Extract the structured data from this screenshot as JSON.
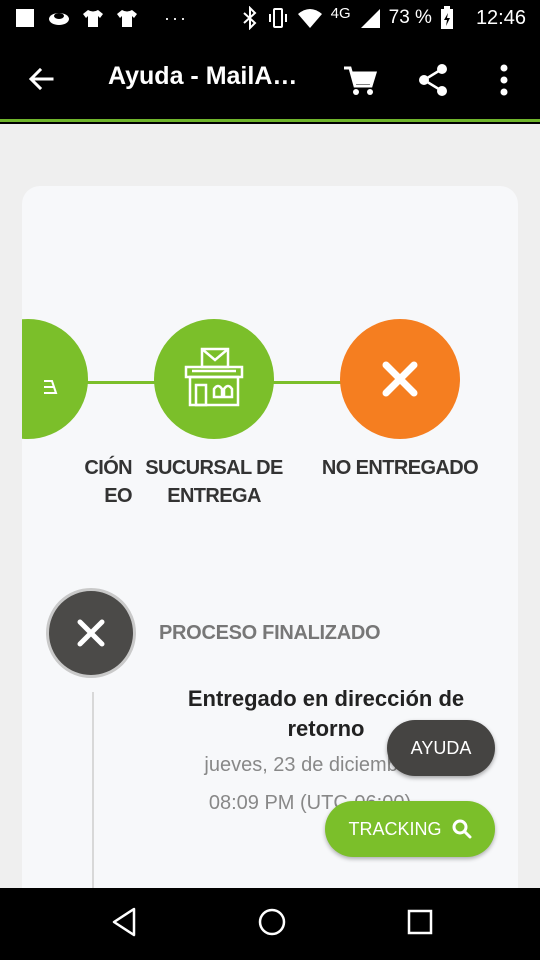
{
  "status_bar": {
    "dots": "···",
    "network": "4G",
    "battery": "73 %",
    "time": "12:46"
  },
  "app_bar": {
    "title": "Ayuda - MailA…"
  },
  "steps": [
    {
      "label_line1": "CIÓN",
      "label_line2": "EO",
      "color": "#7bbf2a",
      "icon": "partial-step-icon"
    },
    {
      "label_line1": "SUCURSAL DE",
      "label_line2": "ENTREGA",
      "color": "#7bbf2a",
      "icon": "post-office-icon"
    },
    {
      "label_line1": "NO ENTREGADO",
      "label_line2": "",
      "color": "#f57e20",
      "icon": "close-x-icon"
    }
  ],
  "status": {
    "heading": "PROCESO FINALIZADO"
  },
  "event": {
    "title": "Entregado en dirección de retorno",
    "date": "jueves, 23 de diciembre",
    "time": "08:09 PM (UTC-06:00)"
  },
  "buttons": {
    "ayuda": "AYUDA",
    "tracking": "TRACKING"
  },
  "colors": {
    "accent_green": "#7bbf2a",
    "accent_orange": "#f57e20",
    "dark_gray": "#454442"
  }
}
